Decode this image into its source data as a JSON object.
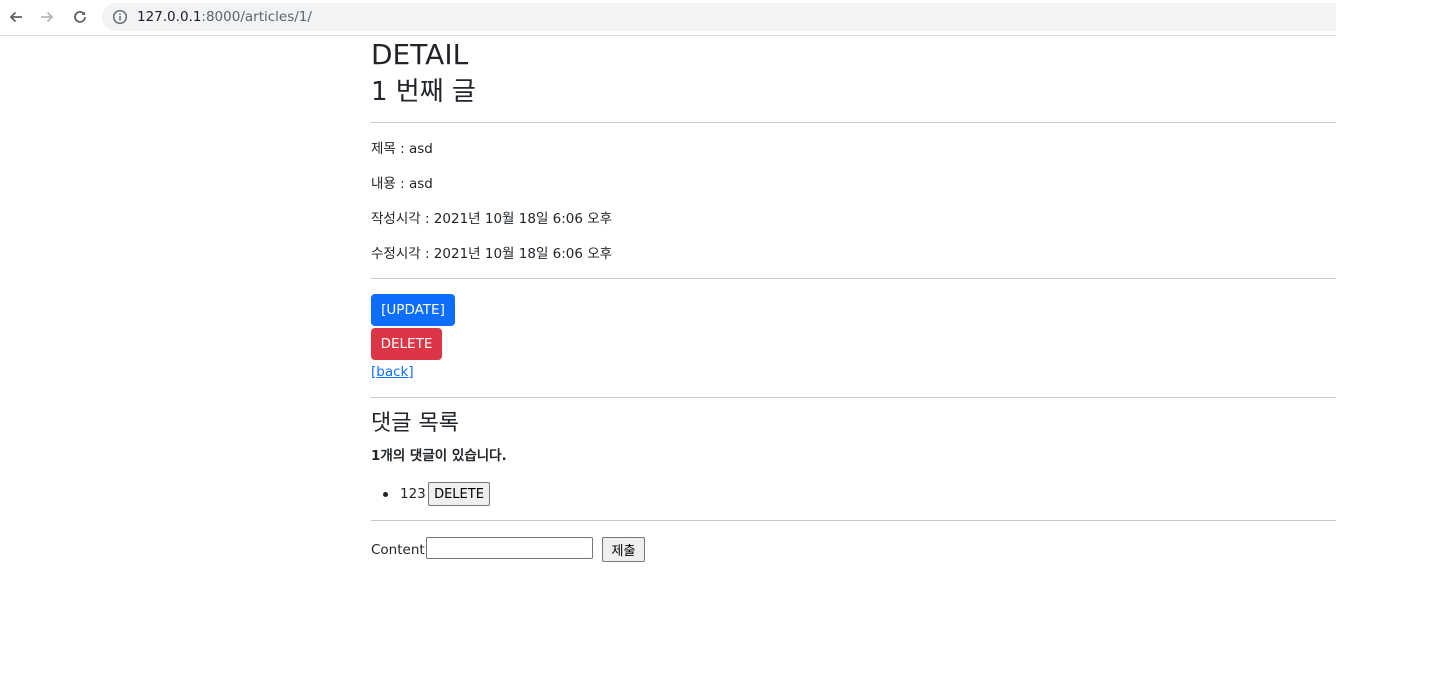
{
  "browser": {
    "url_host": "127.0.0.1",
    "url_path": ":8000/articles/1/",
    "icons": [
      "back-arrow-icon",
      "forward-arrow-icon",
      "reload-icon",
      "info-icon"
    ]
  },
  "article": {
    "heading": "DETAIL",
    "subheading": "1 번째 글",
    "title_line": "제목 : asd",
    "content_line": "내용 : asd",
    "created_line": "작성시각 : 2021년 10월 18일 6:06 오후",
    "updated_line": "수정시각 : 2021년 10월 18일 6:06 오후"
  },
  "actions": {
    "update_label": "[UPDATE]",
    "delete_label": "DELETE",
    "back_label": "[back]"
  },
  "comments": {
    "heading": "댓글 목록",
    "count_text": "1개의 댓글이 있습니다.",
    "items": [
      {
        "content": "123",
        "delete_label": "DELETE"
      }
    ]
  },
  "comment_form": {
    "label": "Content:",
    "value": "",
    "submit_label": "제출"
  },
  "colors": {
    "primary": "#0d6efd",
    "danger": "#dc3545",
    "link": "#0d6efd",
    "divider": "#c8c8c8"
  }
}
